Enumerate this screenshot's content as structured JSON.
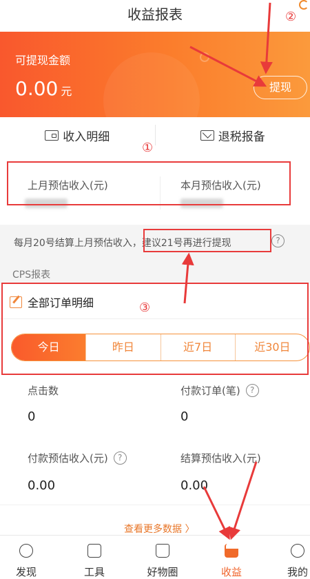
{
  "header": {
    "title": "收益报表"
  },
  "hero": {
    "label": "可提现金额",
    "amount": "0.00",
    "unit": "元",
    "withdraw_label": "提现"
  },
  "quicklinks": [
    {
      "label": "收入明细",
      "icon": "wallet-icon"
    },
    {
      "label": "退税报备",
      "icon": "mail-icon"
    }
  ],
  "estimates": {
    "last_month_label": "上月预估收入(元)",
    "this_month_label": "本月预估收入(元)"
  },
  "notice": {
    "text": "每月20号结算上月预估收入，建议21号再进行提现",
    "help": "?"
  },
  "section": {
    "label": "CPS报表"
  },
  "orders": {
    "title": "全部订单明细",
    "tabs": [
      "今日",
      "昨日",
      "近7日",
      "近30日"
    ],
    "active_tab": "今日",
    "metrics": {
      "clicks_label": "点击数",
      "clicks_value": "0",
      "paid_orders_label": "付款订单(笔)",
      "paid_orders_value": "0",
      "paid_estimate_label": "付款预估收入(元)",
      "paid_estimate_value": "0.00",
      "settle_estimate_label": "结算预估收入(元)",
      "settle_estimate_value": "0.00"
    }
  },
  "more": {
    "label": "查看更多数据 〉"
  },
  "tabbar": [
    {
      "label": "发现",
      "icon": "discover-icon"
    },
    {
      "label": "工具",
      "icon": "toolbox-icon"
    },
    {
      "label": "好物圈",
      "icon": "bag-icon"
    },
    {
      "label": "收益",
      "icon": "chart-icon",
      "active": true
    },
    {
      "label": "我的",
      "icon": "profile-icon"
    }
  ],
  "annotations": {
    "c1": "①",
    "c2": "②",
    "c3": "③"
  },
  "colors": {
    "accent": "#fb6a2c",
    "annotation": "#e83a3a"
  }
}
